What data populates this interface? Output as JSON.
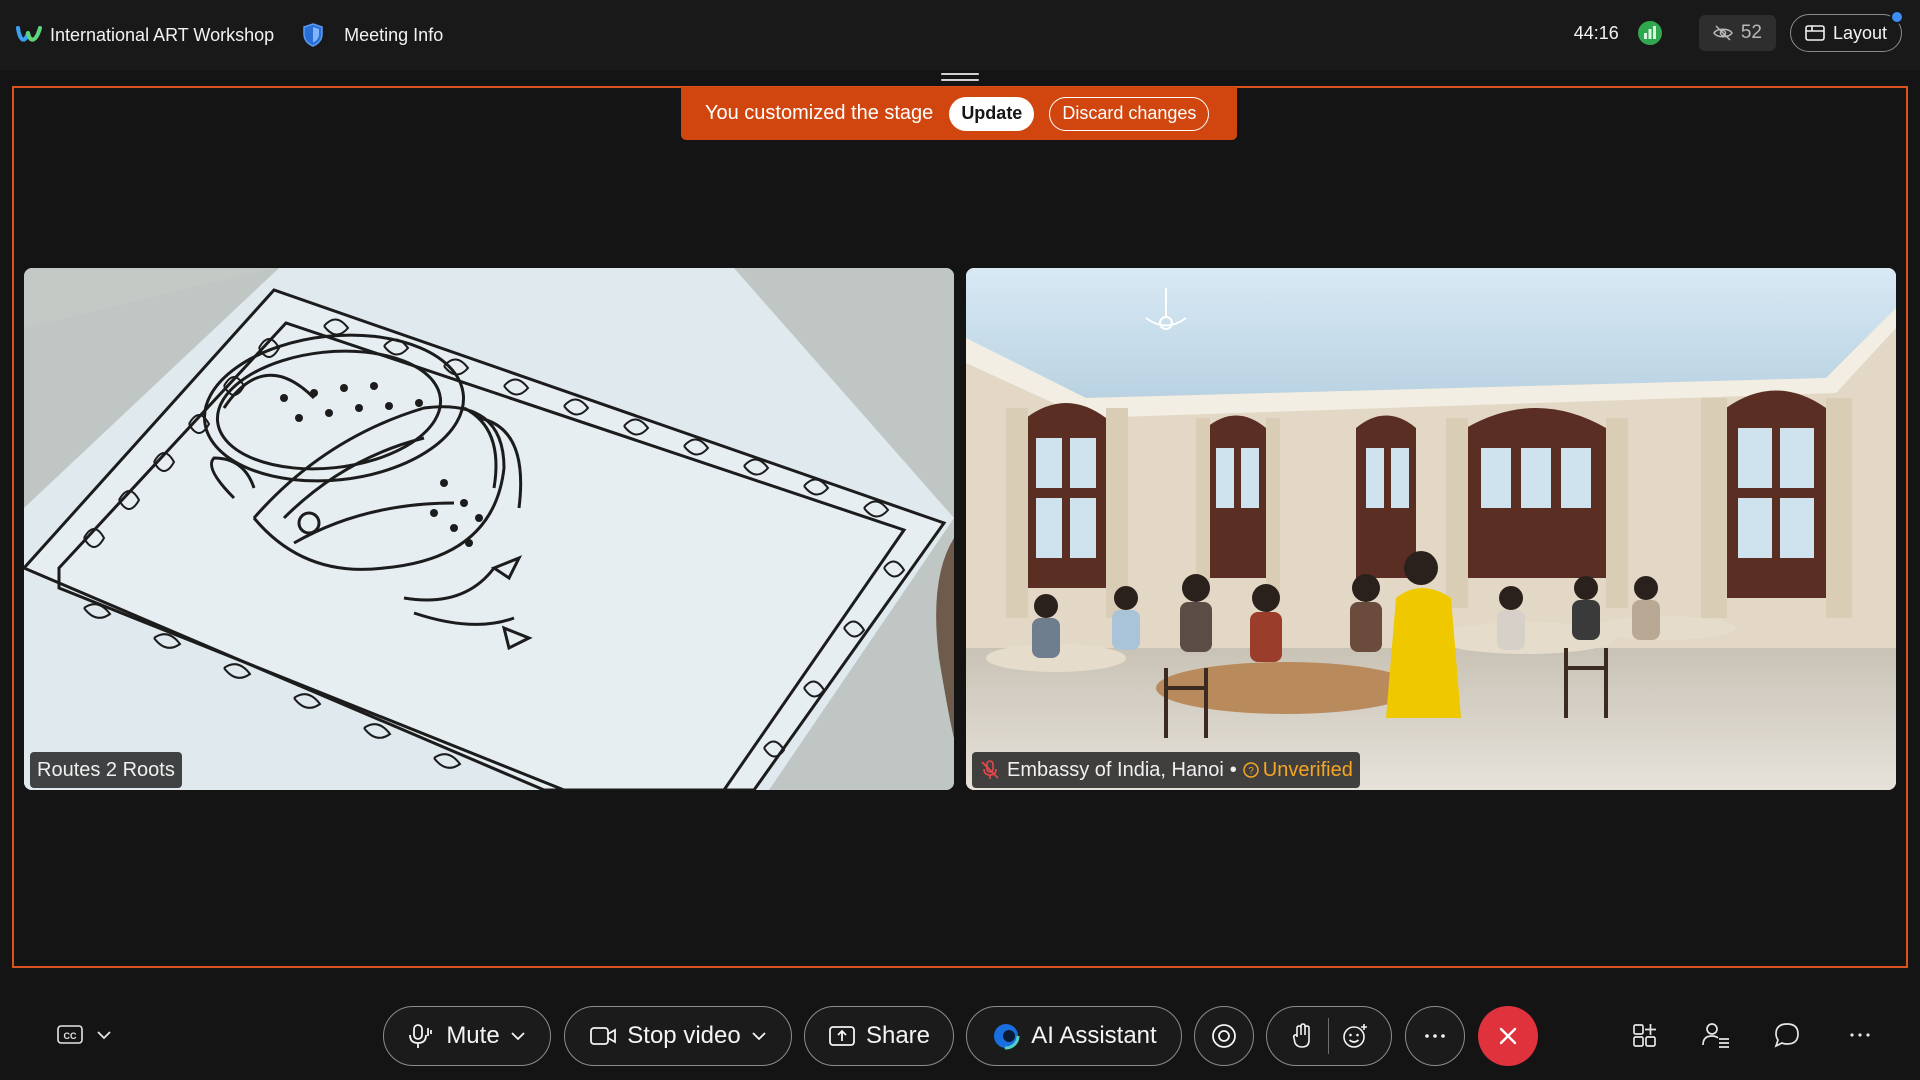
{
  "topbar": {
    "meeting_title": "International ART Workshop",
    "meeting_info_label": "Meeting Info",
    "timer": "44:16",
    "hidden_participants": "52",
    "layout_label": "Layout"
  },
  "banner": {
    "text": "You customized the stage",
    "update_label": "Update",
    "discard_label": "Discard changes"
  },
  "tiles": [
    {
      "name": "Routes 2 Roots",
      "muted": false
    },
    {
      "name": "Embassy of India, Hanoi",
      "separator": "•",
      "status": "Unverified",
      "muted": true
    }
  ],
  "controls": {
    "mute_label": "Mute",
    "video_label": "Stop video",
    "share_label": "Share",
    "ai_label": "AI Assistant"
  },
  "colors": {
    "accent_orange": "#d1460f",
    "end_call_red": "#e0323c",
    "unverified_amber": "#f5a623",
    "signal_green": "#2fa84f"
  },
  "icons": [
    "cc-icon",
    "microphone-icon",
    "camera-icon",
    "share-icon",
    "ai-assistant-icon",
    "record-icon",
    "raise-hand-icon",
    "reactions-icon",
    "more-icon",
    "end-call-icon",
    "apps-icon",
    "participants-icon",
    "chat-icon"
  ]
}
